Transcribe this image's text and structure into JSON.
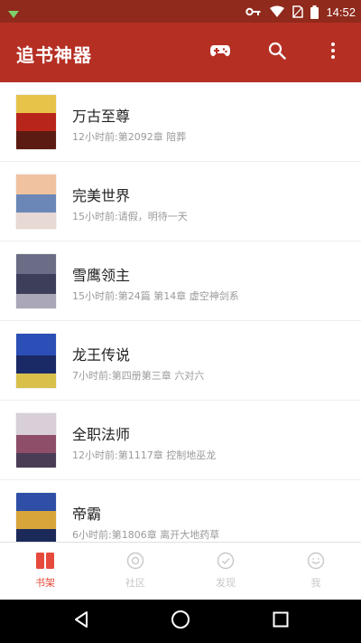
{
  "status_bar": {
    "time": "14:52",
    "icons": [
      "notification-icon",
      "vpn-key-icon",
      "wifi-icon",
      "no-sim-icon",
      "battery-icon"
    ]
  },
  "app_bar": {
    "title": "追书神器",
    "actions": [
      "gamepad-icon",
      "search-icon",
      "more-vert-icon"
    ]
  },
  "books": [
    {
      "title": "万古至尊",
      "subtitle": "12小时前:第2092章 陪葬",
      "cover_colors": [
        "#e8c34a",
        "#b8251a",
        "#5b1b12"
      ]
    },
    {
      "title": "完美世界",
      "subtitle": "15小时前:请假，明待一天",
      "cover_colors": [
        "#f1c2a0",
        "#6a87b8",
        "#e7d9d3"
      ]
    },
    {
      "title": "雪鹰领主",
      "subtitle": "15小时前:第24篇 第14章 虚空神剑系",
      "cover_colors": [
        "#6b6d86",
        "#3d3f5a",
        "#a9a7b8"
      ]
    },
    {
      "title": "龙王传说",
      "subtitle": "7小时前:第四册第三章 六对六",
      "cover_colors": [
        "#2b4fb6",
        "#1a2a66",
        "#d9c04a"
      ]
    },
    {
      "title": "全职法师",
      "subtitle": "12小时前:第1117章 控制地巫龙",
      "cover_colors": [
        "#d9cfd8",
        "#8e4e6a",
        "#4b3c56"
      ]
    },
    {
      "title": "帝霸",
      "subtitle": "6小时前:第1806章 离开大地药草",
      "cover_colors": [
        "#2f4fa6",
        "#d8a53b",
        "#1c2a5a"
      ]
    }
  ],
  "bottom_nav": {
    "tabs": [
      {
        "label": "书架",
        "icon": "bookshelf-icon",
        "active": true
      },
      {
        "label": "社区",
        "icon": "community-icon",
        "active": false
      },
      {
        "label": "发现",
        "icon": "discover-icon",
        "active": false
      },
      {
        "label": "我",
        "icon": "profile-icon",
        "active": false
      }
    ]
  },
  "colors": {
    "status_bar": "#8f2a1c",
    "app_bar": "#b52f23",
    "accent": "#e64a3c",
    "inactive": "#c8c8c8"
  }
}
